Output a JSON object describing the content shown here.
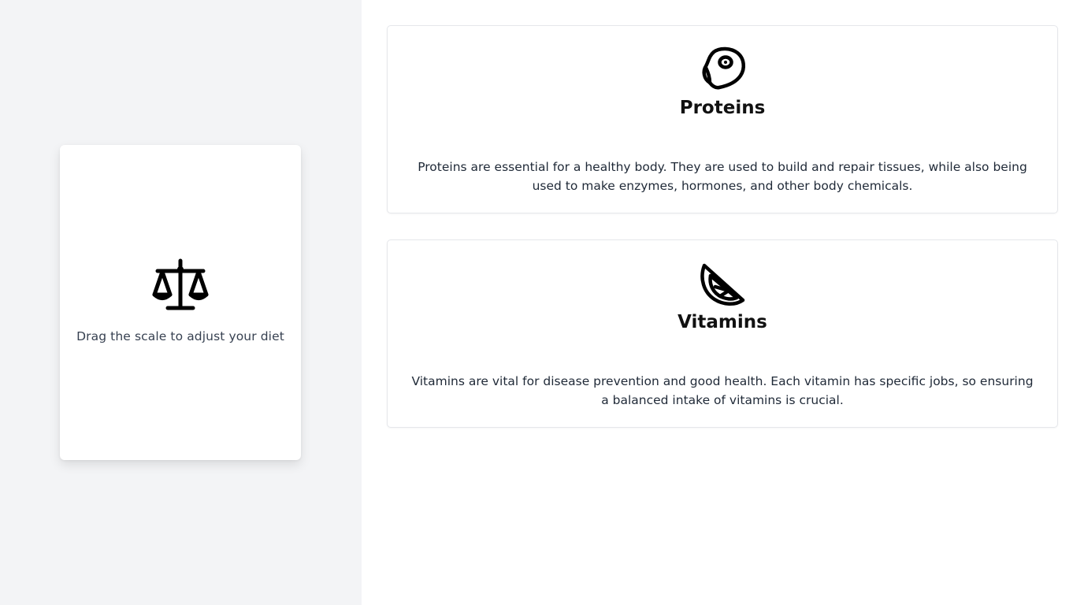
{
  "left_panel": {
    "icon": "scale-icon",
    "caption": "Drag the scale to adjust your diet"
  },
  "cards": [
    {
      "icon": "meat-icon",
      "title": "Proteins",
      "description": "Proteins are essential for a healthy body. They are used to build and repair tissues, while also being used to make enzymes, hormones, and other body chemicals."
    },
    {
      "icon": "citrus-icon",
      "title": "Vitamins",
      "description": "Vitamins are vital for disease prevention and good health. Each vitamin has specific jobs, so ensuring a balanced intake of vitamins is crucial."
    }
  ],
  "colors": {
    "left_background": "#f3f4f6",
    "card_border": "#e5e7eb",
    "text": "#111111"
  }
}
